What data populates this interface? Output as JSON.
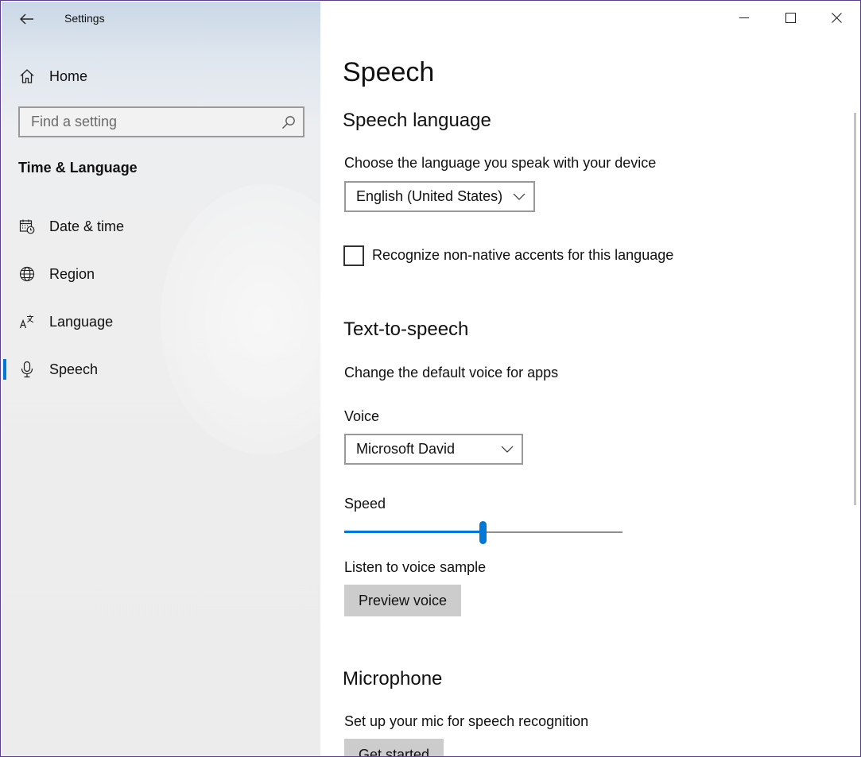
{
  "window": {
    "app_title": "Settings",
    "caption_buttons": [
      "minimize-icon",
      "maximize-icon",
      "close-icon"
    ]
  },
  "sidebar": {
    "home_label": "Home",
    "search": {
      "placeholder": "Find a setting"
    },
    "section_title": "Time & Language",
    "items": [
      {
        "label": "Date & time",
        "icon": "calendar-clock-icon",
        "selected": false
      },
      {
        "label": "Region",
        "icon": "globe-icon",
        "selected": false
      },
      {
        "label": "Language",
        "icon": "language-icon",
        "selected": false
      },
      {
        "label": "Speech",
        "icon": "microphone-icon",
        "selected": true
      }
    ],
    "accent_color": "#0078d7"
  },
  "main": {
    "page_title": "Speech",
    "speech_language": {
      "heading": "Speech language",
      "prompt": "Choose the language you speak with your device",
      "selected_language": "English (United States)",
      "accents_checkbox_label": "Recognize non-native accents for this language",
      "accents_checked": false
    },
    "text_to_speech": {
      "heading": "Text-to-speech",
      "description": "Change the default voice for apps",
      "voice_label": "Voice",
      "voice_value": "Microsoft David",
      "speed_label": "Speed",
      "speed_fraction": 0.5,
      "sample_label": "Listen to voice sample",
      "preview_button": "Preview voice"
    },
    "microphone": {
      "heading": "Microphone",
      "description": "Set up your mic for speech recognition",
      "get_started_button": "Get started"
    }
  }
}
